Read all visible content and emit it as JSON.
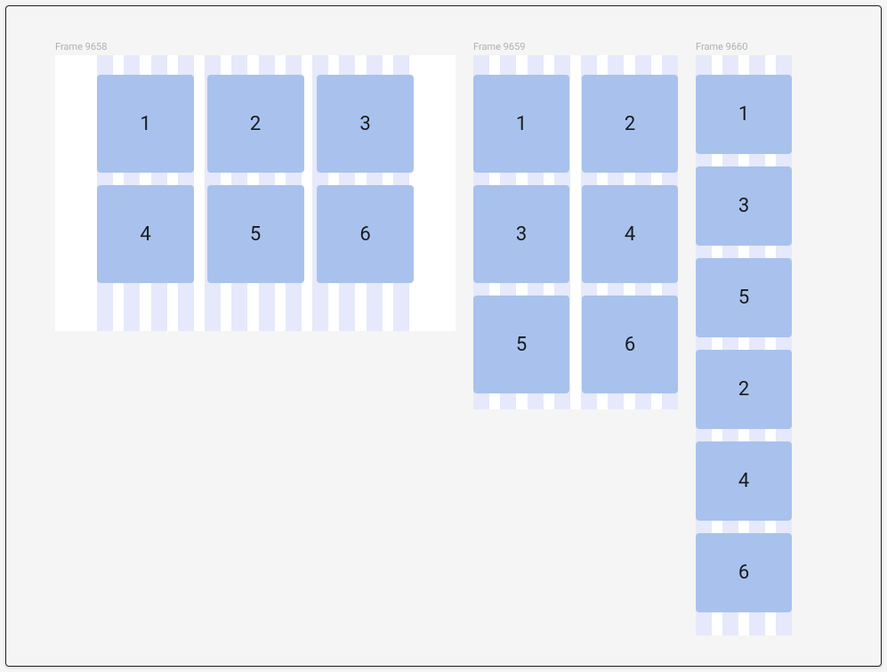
{
  "frames": [
    {
      "label": "Frame 9658",
      "columns_visible": 12,
      "card_layout_cols": 3,
      "card_layout_rows": 2,
      "cards": [
        "1",
        "2",
        "3",
        "4",
        "5",
        "6"
      ]
    },
    {
      "label": "Frame 9659",
      "columns_visible": 8,
      "card_layout_cols": 2,
      "card_layout_rows": 3,
      "cards": [
        "1",
        "2",
        "3",
        "4",
        "5",
        "6"
      ]
    },
    {
      "label": "Frame 9660",
      "columns_visible": 4,
      "card_layout_cols": 1,
      "card_layout_rows": 6,
      "cards": [
        "1",
        "3",
        "5",
        "2",
        "4",
        "6"
      ]
    }
  ],
  "colors": {
    "canvas_bg": "#f5f5f5",
    "frame_bg": "#ffffff",
    "grid_col": "#e6e9fb",
    "card_bg": "#a8c2ed",
    "label": "#b0b0b0"
  }
}
